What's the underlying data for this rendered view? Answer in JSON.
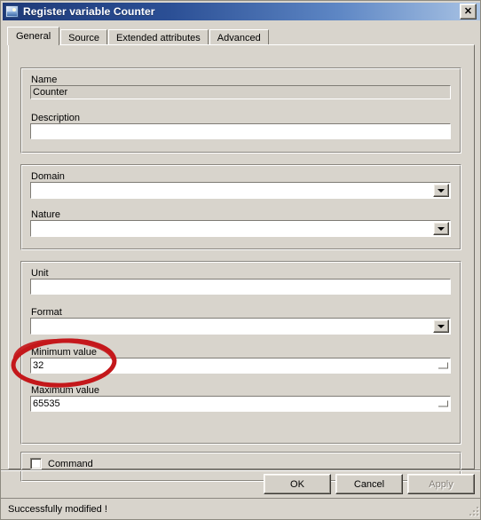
{
  "window": {
    "title": "Register variable Counter",
    "icon": "variable-icon",
    "close_label": "✕"
  },
  "tabs": [
    {
      "label": "General",
      "active": true
    },
    {
      "label": "Source",
      "active": false
    },
    {
      "label": "Extended attributes",
      "active": false
    },
    {
      "label": "Advanced",
      "active": false
    }
  ],
  "groups": [
    {
      "name": "identity",
      "fields": [
        {
          "type": "text",
          "label": "Name",
          "value": "Counter",
          "disabled": true
        },
        {
          "type": "text",
          "label": "Description",
          "value": "",
          "disabled": false
        }
      ]
    },
    {
      "name": "classification",
      "fields": [
        {
          "type": "combo",
          "label": "Domain",
          "value": ""
        },
        {
          "type": "combo",
          "label": "Nature",
          "value": ""
        }
      ]
    },
    {
      "name": "representation",
      "fields": [
        {
          "type": "text",
          "label": "Unit",
          "value": "",
          "disabled": false
        },
        {
          "type": "combo",
          "label": "Format",
          "value": ""
        },
        {
          "type": "text",
          "label": "Minimum value",
          "value": "32",
          "disabled": false,
          "browse": true
        },
        {
          "type": "text",
          "label": "Maximum value",
          "value": "65535",
          "disabled": false,
          "browse": true
        }
      ]
    },
    {
      "name": "options",
      "fields": [
        {
          "type": "checkbox",
          "label": "Command",
          "checked": false
        }
      ]
    }
  ],
  "buttons": {
    "ok": "OK",
    "cancel": "Cancel",
    "apply": "Apply",
    "apply_enabled": false
  },
  "statusbar": {
    "message": "Successfully modified !"
  },
  "annotation": {
    "shape": "ellipse",
    "color": "#c4181b",
    "targets": "Minimum value"
  },
  "colors": {
    "dialog_face": "#d8d4cc",
    "title_left": "#1e3a78",
    "title_right": "#a9c3e4",
    "field_bg": "#ffffff",
    "disabled_field_bg": "#d4d0c8",
    "annotation_red": "#c4181b"
  }
}
